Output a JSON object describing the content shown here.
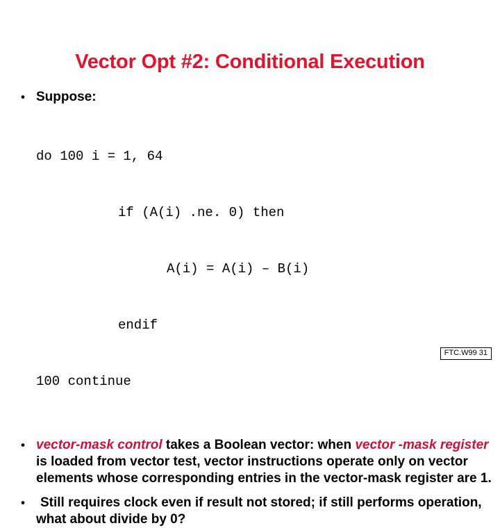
{
  "slide": {
    "title": "Vector Opt #2: Conditional Execution",
    "title_color": "#e8112d",
    "background_color": "#ffffff",
    "text_color": "#000000",
    "accent_color": "#d0103a"
  },
  "bullets": {
    "b1": {
      "mark": "•",
      "label": "Suppose:"
    },
    "b2": {
      "mark": "•",
      "seg1": "vector-mask control",
      "seg2": " takes a Boolean vector: when ",
      "seg3": "vector -mask register",
      "seg4": " is loaded from vector test, vector instructions operate only on vector elements whose corresponding entries in the vector-mask register are 1."
    },
    "b3": {
      "mark": "•",
      "label": "Still requires clock even if result not stored; if still performs operation, what about divide by 0?"
    }
  },
  "code": {
    "lines": [
      {
        "indent": 0,
        "text": "do 100 i = 1, 64"
      },
      {
        "indent": 2,
        "text": "if (A(i) .ne. 0) then"
      },
      {
        "indent": 3,
        "text": "A(i) = A(i) – B(i)"
      },
      {
        "indent": 2,
        "text": "endif"
      },
      {
        "indent": 0,
        "text": "100 continue"
      }
    ]
  },
  "footer": {
    "badge": "FTC.W99 31"
  }
}
